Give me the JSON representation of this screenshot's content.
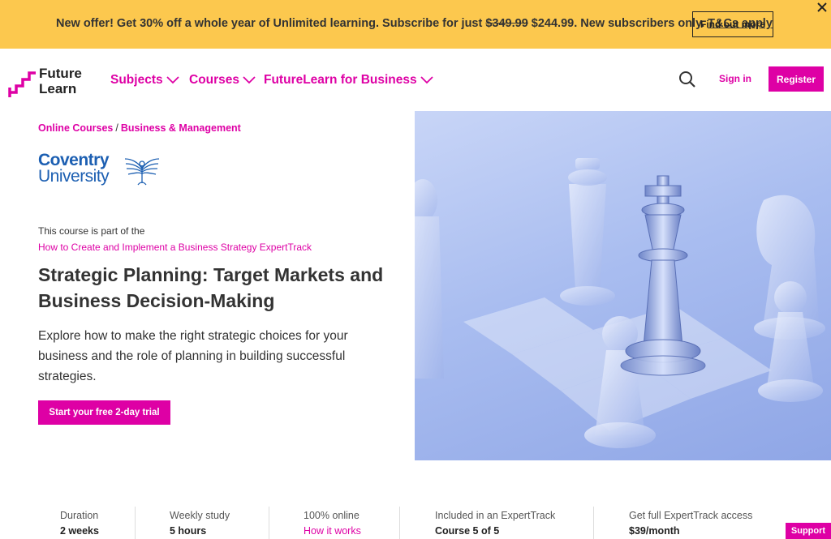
{
  "promo": {
    "text_before": "New offer! Get 30% off a whole year of Unlimited learning. Subscribe for just ",
    "old_price": "$349.99",
    "text_after": " $244.99. New subscribers only. ",
    "terms_link": "T&Cs apply",
    "button_label": "Find out more",
    "close_icon": "close-icon",
    "background": "#fcc84e"
  },
  "header": {
    "logo_line1": "Future",
    "logo_line2": "Learn",
    "nav": [
      {
        "label": "Subjects"
      },
      {
        "label": "Courses"
      },
      {
        "label": "FutureLearn for Business"
      }
    ],
    "search_icon": "search-icon",
    "signin_label": "Sign in",
    "register_label": "Register"
  },
  "breadcrumb": {
    "item1": "Online Courses",
    "separator": "/",
    "item2": "Business & Management"
  },
  "university": {
    "line1": "Coventry",
    "line2": "University",
    "emblem_icon": "phoenix-icon"
  },
  "course": {
    "part_of_text": "This course is part of the",
    "expert_track_link": "How to Create and Implement a Business Strategy ExpertTrack",
    "title": "Strategic Planning: Target Markets and Business Decision-Making",
    "description": "Explore how to make the right strategic choices for your business and the role of planning in building successful strategies.",
    "cta_label": "Start your free 2-day trial"
  },
  "facts": [
    {
      "label": "Duration",
      "value": "2 weeks"
    },
    {
      "label": "Weekly study",
      "value": "5 hours"
    },
    {
      "label": "100% online",
      "value": "How it works"
    },
    {
      "label": "Included in an ExpertTrack",
      "value": "Course 5 of 5"
    },
    {
      "label": "Get full ExpertTrack access",
      "value": "$39/month"
    }
  ],
  "support_label": "Support",
  "colors": {
    "accent": "#de00a5",
    "text": "#333333",
    "university_blue": "#1c5fb2"
  }
}
